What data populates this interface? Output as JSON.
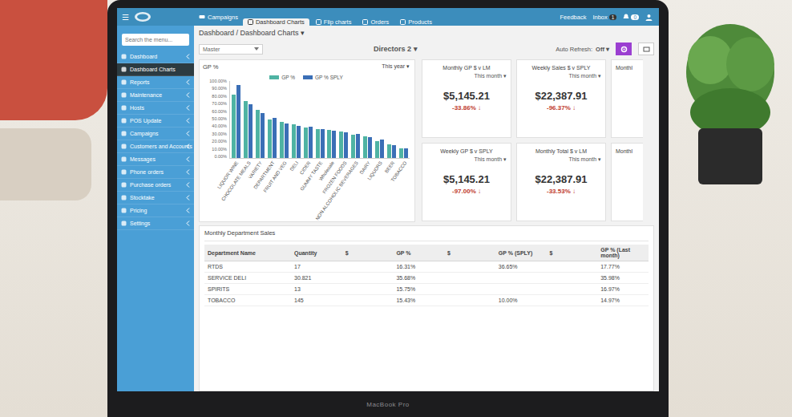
{
  "laptop": {
    "label": "MacBook Pro"
  },
  "topbar": {
    "menu_icon": "☰",
    "nav_label": "Campaigns",
    "tabs": [
      {
        "label": "Dashboard Charts",
        "selected": true
      },
      {
        "label": "Flip charts",
        "selected": false
      },
      {
        "label": "Orders",
        "selected": false
      },
      {
        "label": "Products",
        "selected": false
      }
    ],
    "feedback": "Feedback",
    "inbox": {
      "label": "Inbox",
      "badge": "1"
    },
    "alerts_badge": "0"
  },
  "sidebar": {
    "search_placeholder": "Search the menu...",
    "items": [
      {
        "label": "Dashboard",
        "selected": false,
        "expandable": true
      },
      {
        "label": "Dashboard Charts",
        "selected": true,
        "expandable": false
      },
      {
        "label": "Reports",
        "selected": false,
        "expandable": true
      },
      {
        "label": "Maintenance",
        "selected": false,
        "expandable": true
      },
      {
        "label": "Hosts",
        "selected": false,
        "expandable": true
      },
      {
        "label": "POS Update",
        "selected": false,
        "expandable": true
      },
      {
        "label": "Campaigns",
        "selected": false,
        "expandable": true
      },
      {
        "label": "Customers and Accounts",
        "selected": false,
        "expandable": true
      },
      {
        "label": "Messages",
        "selected": false,
        "expandable": true
      },
      {
        "label": "Phone orders",
        "selected": false,
        "expandable": true
      },
      {
        "label": "Purchase orders",
        "selected": false,
        "expandable": true
      },
      {
        "label": "Stocktake",
        "selected": false,
        "expandable": true
      },
      {
        "label": "Pricing",
        "selected": false,
        "expandable": true
      },
      {
        "label": "Settings",
        "selected": false,
        "expandable": true
      }
    ]
  },
  "page": {
    "breadcrumb": "Dashboard / Dashboard Charts ▾",
    "store_select": "Master",
    "dashboard_title": "Directors 2 ▾",
    "auto_refresh_label": "Auto Refresh:",
    "auto_refresh_value": "Off ▾"
  },
  "chart": {
    "title": "GP %",
    "period": "This year ▾",
    "y_ticks": [
      "100.00%",
      "90.00%",
      "80.00%",
      "70.00%",
      "60.00%",
      "50.00%",
      "40.00%",
      "30.00%",
      "20.00%",
      "10.00%",
      "0.00%"
    ],
    "categories": [
      "LIQUOR WINE",
      "CHOCOLATE MEALS",
      "VARIETY",
      "DEPARTMENT",
      "FRUIT AND VEG",
      "DELI",
      "CIDER",
      "GUMMY TASTE",
      "Wholesale",
      "FROZEN FOODS",
      "NON ALCOHOLIC BEVERAGES",
      "DAIRY",
      "LIQUORS",
      "BEER",
      "TOBACCO"
    ],
    "series": [
      {
        "label": "GP %",
        "color": "#4fb3a3",
        "values": [
          82,
          74,
          62,
          50,
          47,
          44,
          40,
          38,
          36,
          34,
          30,
          28,
          22,
          18,
          13
        ]
      },
      {
        "label": "GP % SPLY",
        "color": "#3b6fb6",
        "values": [
          95,
          70,
          58,
          52,
          45,
          42,
          41,
          37,
          35,
          33,
          31,
          27,
          24,
          17,
          12
        ]
      }
    ]
  },
  "cards": [
    {
      "kind": "metric",
      "title": "Monthly GP $ v LM",
      "period": "This month ▾",
      "value": "$5,145.21",
      "change": "-33.86%",
      "arrow": "↓"
    },
    {
      "kind": "metric",
      "title": "Weekly Sales $ v SPLY",
      "period": "This month ▾",
      "value": "$22,387.91",
      "change": "-96.37%",
      "arrow": "↓"
    },
    {
      "kind": "clipped",
      "title": "Monthl"
    },
    {
      "kind": "metric",
      "title": "Weekly GP $ v SPLY",
      "period": "This month ▾",
      "value": "$5,145.21",
      "change": "-97.00%",
      "arrow": "↓"
    },
    {
      "kind": "metric",
      "title": "Monthly Total $ v LM",
      "period": "This month ▾",
      "value": "$22,387.91",
      "change": "-33.53%",
      "arrow": "↓"
    },
    {
      "kind": "clipped",
      "title": "Monthl"
    }
  ],
  "table": {
    "title": "Monthly Department Sales",
    "columns": [
      "Department Name",
      "Quantity",
      "$",
      "GP %",
      "$",
      "GP % (SPLY)",
      "$",
      "GP % (Last month)"
    ],
    "rows": [
      [
        "RTDS",
        "17",
        "",
        "16.31%",
        "",
        "36.65%",
        "",
        "17.77%"
      ],
      [
        "SERVICE DELI",
        "30.821",
        "",
        "35.68%",
        "",
        "",
        "",
        "35.98%"
      ],
      [
        "SPIRITS",
        "13",
        "",
        "15.75%",
        "",
        "",
        "",
        "16.97%"
      ],
      [
        "TOBACCO",
        "145",
        "",
        "15.43%",
        "",
        "10.00%",
        "",
        "14.97%"
      ]
    ]
  }
}
